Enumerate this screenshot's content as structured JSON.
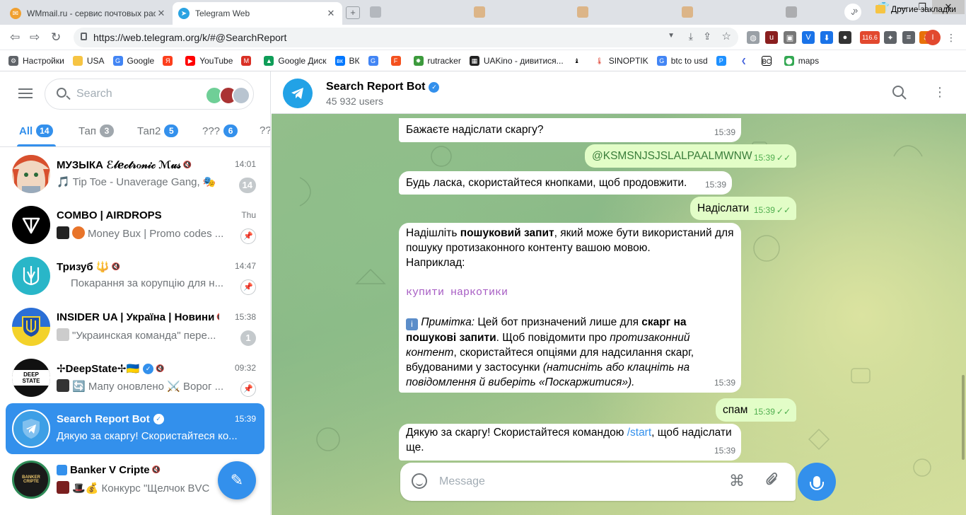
{
  "browser": {
    "tabs": [
      {
        "title": "WMmail.ru - сервис почтовых рас",
        "favicon": "wmmail-icon",
        "active": false
      },
      {
        "title": "Telegram Web",
        "favicon": "telegram-icon",
        "active": true
      }
    ],
    "url": "https://web.telegram.org/k/#@SearchReport",
    "bookmarks": [
      "Настройки",
      "USA",
      "Google",
      "Я",
      "YouTube",
      "M",
      "Google Диск",
      "ВК",
      "",
      "F",
      "rutracker",
      "UAKino - дивитися...",
      "",
      "",
      "SINOPTIK",
      "btc to usd",
      "P",
      "",
      "BC",
      "maps"
    ],
    "other_bookmarks": "Другие закладки",
    "more_bookmarks": "»",
    "extension_badge": "116.6",
    "profile_letter": "I"
  },
  "sidebar": {
    "search_placeholder": "Search",
    "folders": [
      {
        "label": "All",
        "count": "14"
      },
      {
        "label": "Тап",
        "count": "3"
      },
      {
        "label": "Тап2",
        "count": "5"
      },
      {
        "label": "???",
        "count": "6"
      },
      {
        "label": "??",
        "count": ""
      }
    ],
    "chats": [
      {
        "name": "МУЗЫКА ℰ𝓁ℯ𝒸𝓉𝓇ℴ𝓃𝒾𝒸 ℳ𝓊𝓈",
        "time": "14:01",
        "preview": "🎵 Tip Toe - Unaverage Gang, 🎭",
        "badge": "14"
      },
      {
        "name": "COMBO | AIRDROPS",
        "time": "Thu",
        "preview": "Money Bux | Promo codes ..."
      },
      {
        "name": "Тризуб 🔱",
        "time": "14:47",
        "preview": "Покарання за корупцію для н..."
      },
      {
        "name": "INSIDER UA | Україна | Новини",
        "time": "15:38",
        "preview": "\"Украинская команда\" пере...",
        "badge": "1"
      },
      {
        "name": "✢DeepState✢🇺🇦",
        "time": "09:32",
        "preview": "🔄 Мапу оновлено ⚔️ Ворог ..."
      },
      {
        "name": "Search Report Bot",
        "time": "15:39",
        "preview": "Дякую за скаргу! Скористайтеся ко..."
      },
      {
        "name": "Banker V Cripte",
        "time": "",
        "preview": "🎩💰 Конкурс \"Щелчок BVC"
      }
    ],
    "avatar_text": {
      "deepstate": "DEEP STATE",
      "banker": "BANKER CRIPTE"
    }
  },
  "chat": {
    "title": "Search Report Bot",
    "subtitle": "45 932 users",
    "messages": {
      "m1": {
        "text": "Бажаєте надіслати скаргу?",
        "time": "15:39"
      },
      "m2": {
        "text": "@KSMSNJSJSLALPAALMWNW",
        "time": "15:39"
      },
      "m3": {
        "text": "Будь ласка, скористайтеся кнопками, щоб продовжити.",
        "time": "15:39"
      },
      "m4": {
        "text": "Надіслати",
        "time": "15:39"
      },
      "m5": {
        "p1a": "Надішліть ",
        "p1b": "пошуковий запит",
        "p1c": ", який може бути використаний для пошуку протизаконного контенту вашою мовою.",
        "p1d": "Наприклад:",
        "example": "купити наркотики",
        "info_icon": "ℹ️",
        "note": "Примітка:",
        "p2a": " Цей бот призначений лише для ",
        "p2b": "скарг на пошукові запити",
        "p2c": ". Щоб повідомити про ",
        "p2d": "протизаконний контент",
        "p2e": ", скористайтеся опціями для надсилання скарг, вбудованими у застосунки ",
        "p2f": "(натисніть або клацніть на повідомлення й виберіть «Поскаржитися»).",
        "time": "15:39"
      },
      "m6": {
        "text": "спам",
        "time": "15:39"
      },
      "m7": {
        "text_a": "Дякую за скаргу! Скористайтеся командою ",
        "link": "/start",
        "text_b": ", щоб надіслати ще.",
        "time": "15:39"
      }
    },
    "composer_placeholder": "Message"
  },
  "colors": {
    "accent": "#3390ec",
    "outgoing": "#e2fdc7",
    "check": "#4fae4e"
  }
}
